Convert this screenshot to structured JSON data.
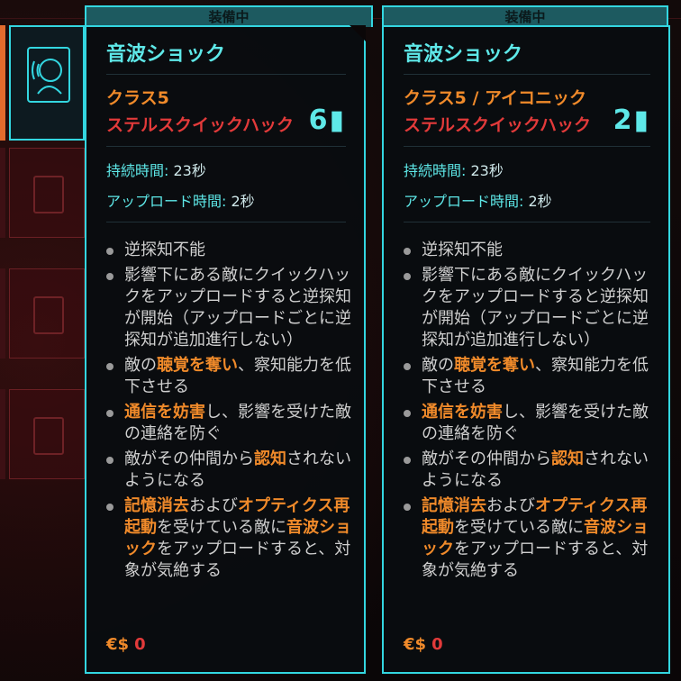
{
  "slots": {
    "equipped_icon": "sonic-shock-icon",
    "empty_icon": "empty-cartridge-icon"
  },
  "cards": [
    {
      "tab": "装備中",
      "title": "音波ショック",
      "class_label": "クラス5",
      "hack_type": "ステルスクイックハック",
      "ram_cost": "6",
      "duration_label": "持続時間:",
      "duration_value": "23秒",
      "upload_label": "アップロード時間:",
      "upload_value": "2秒",
      "effects": [
        "逆探知不能",
        "影響下にある敵にクイックハックをアップロードすると逆探知が開始（アップロードごとに逆探知が追加進行しない）",
        {
          "pre": "敵の",
          "hl": "聴覚を奪い",
          "post": "、察知能力を低下させる"
        },
        {
          "pre": "",
          "hl": "通信を妨害",
          "post": "し、影響を受けた敵の連絡を防ぐ"
        },
        {
          "pre": "敵がその仲間から",
          "hl": "認知",
          "post": "されないようになる"
        },
        {
          "p1": "",
          "h1": "記憶消去",
          "p2": "および",
          "h2": "オプティクス再起動",
          "p3": "を受けている敵に",
          "h3": "音波ショック",
          "p4": "をアップロードすると、対象が気絶する"
        }
      ],
      "price_symbol": "€$",
      "price": "0"
    },
    {
      "tab": "装備中",
      "title": "音波ショック",
      "class_label": "クラス5 / アイコニック",
      "hack_type": "ステルスクイックハック",
      "ram_cost": "2",
      "duration_label": "持続時間:",
      "duration_value": "23秒",
      "upload_label": "アップロード時間:",
      "upload_value": "2秒",
      "effects": [
        "逆探知不能",
        "影響下にある敵にクイックハックをアップロードすると逆探知が開始（アップロードごとに逆探知が追加進行しない）",
        {
          "pre": "敵の",
          "hl": "聴覚を奪い",
          "post": "、察知能力を低下させる"
        },
        {
          "pre": "",
          "hl": "通信を妨害",
          "post": "し、影響を受けた敵の連絡を防ぐ"
        },
        {
          "pre": "敵がその仲間から",
          "hl": "認知",
          "post": "されないようになる"
        },
        {
          "p1": "",
          "h1": "記憶消去",
          "p2": "および",
          "h2": "オプティクス再起動",
          "p3": "を受けている敵に",
          "h3": "音波ショック",
          "p4": "をアップロードすると、対象が気絶する"
        }
      ],
      "price_symbol": "€$",
      "price": "0"
    }
  ]
}
